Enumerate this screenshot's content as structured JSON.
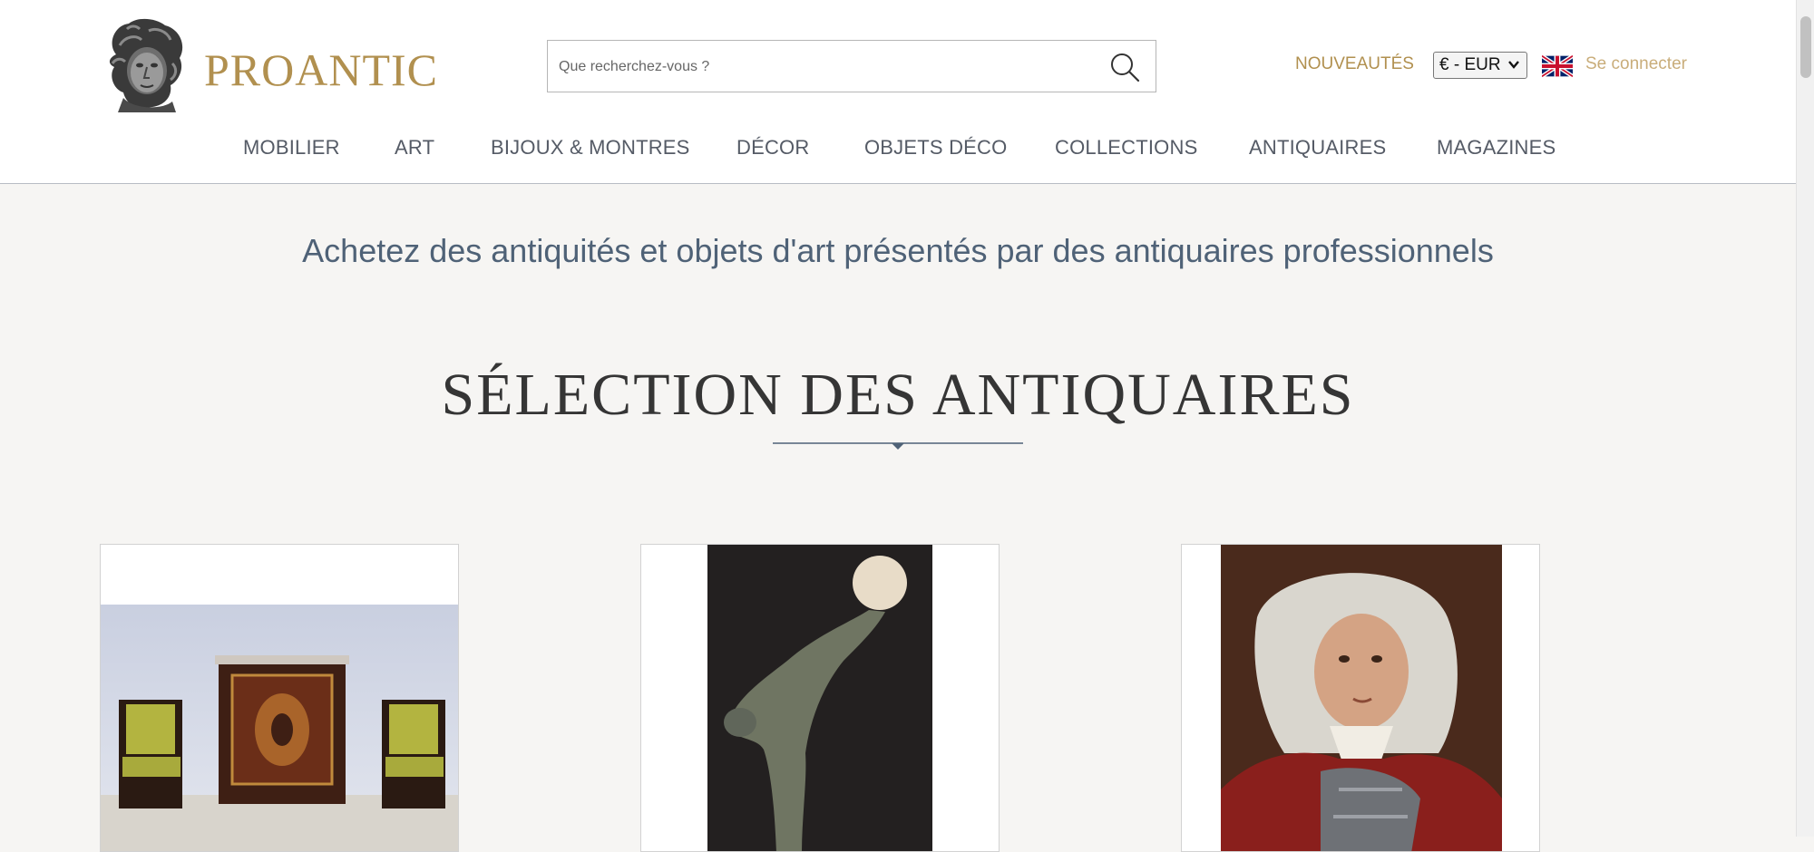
{
  "header": {
    "logo_text": "PROANTIC",
    "search": {
      "placeholder": "Que recherchez-vous ?",
      "value": ""
    },
    "new_label": "NOUVEAUTÉS",
    "currency": {
      "selected": "€ - EUR"
    },
    "login_label": "Se connecter"
  },
  "nav": {
    "items": [
      {
        "label": "MOBILIER"
      },
      {
        "label": "ART"
      },
      {
        "label": "BIJOUX & MONTRES"
      },
      {
        "label": "DÉCOR"
      },
      {
        "label": "OBJETS DÉCO"
      },
      {
        "label": "COLLECTIONS"
      },
      {
        "label": "ANTIQUAIRES"
      },
      {
        "label": "MAGAZINES"
      }
    ]
  },
  "main": {
    "tagline": "Achetez des antiquités et objets d'art présentés par des antiquaires professionnels",
    "section_title": "SÉLECTION DES ANTIQUAIRES"
  },
  "icons": {
    "logo": "classical-head-bust-icon",
    "search": "search-icon",
    "flag": "uk-flag-icon",
    "currency_select": "chevron-down-icon",
    "divider": "diamond-divider"
  },
  "colors": {
    "brand_gold": "#b1904f",
    "login_gold": "#c9ad7a",
    "nav_text": "#555b66",
    "tagline": "#4f6277",
    "page_bg": "#f6f5f3"
  }
}
